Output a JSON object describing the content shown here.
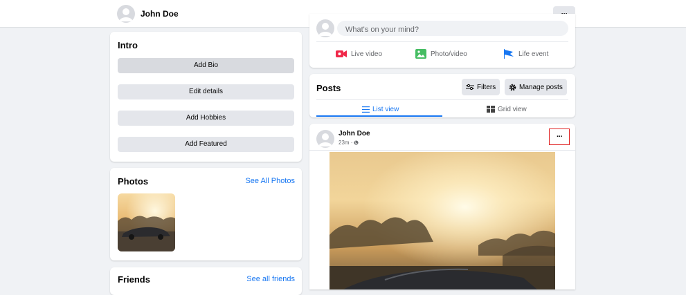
{
  "header": {
    "user_name": "John Doe",
    "more_label": "···"
  },
  "intro": {
    "title": "Intro",
    "buttons": [
      {
        "label": "Add Bio"
      },
      {
        "label": "Edit details"
      },
      {
        "label": "Add Hobbies"
      },
      {
        "label": "Add Featured"
      }
    ]
  },
  "photos": {
    "title": "Photos",
    "see_all": "See All Photos"
  },
  "friends": {
    "title": "Friends",
    "see_all": "See all friends"
  },
  "composer": {
    "placeholder": "What's on your mind?",
    "actions": [
      {
        "label": "Live video",
        "icon": "live-video-icon",
        "color": "#f02849"
      },
      {
        "label": "Photo/video",
        "icon": "photo-video-icon",
        "color": "#45bd62"
      },
      {
        "label": "Life event",
        "icon": "life-event-flag-icon",
        "color": "#1877f2"
      }
    ]
  },
  "posts_bar": {
    "title": "Posts",
    "filters_label": "Filters",
    "manage_label": "Manage posts",
    "list_view_label": "List view",
    "grid_view_label": "Grid view"
  },
  "post": {
    "author": "John Doe",
    "time": "23m ·",
    "more_label": "···"
  },
  "colors": {
    "accent": "#1877f2",
    "highlight_border": "#e02424",
    "background": "#f0f2f5"
  }
}
